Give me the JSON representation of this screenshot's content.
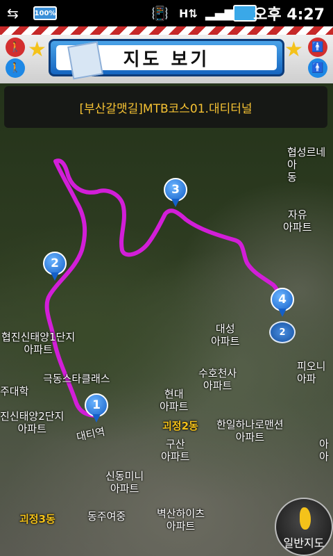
{
  "status_bar": {
    "battery": "100%",
    "time": "오후 4:27"
  },
  "header": {
    "title": "지도 보기"
  },
  "course": {
    "name": "[부산갈맷길]MTB코스01.대티터널"
  },
  "markers": [
    {
      "number": "1"
    },
    {
      "number": "2"
    },
    {
      "number": "3"
    },
    {
      "number": "4"
    }
  ],
  "page_badge": "2",
  "map_labels": {
    "hyupseong": "협성르네\n아\n동",
    "jayu": "자유\n아파트",
    "jinsin1": "협진신태양1단지\n아파트",
    "daeseong": "대성\n아파트",
    "piony": "피오니\n아파",
    "daehak": "주대학",
    "gukdong": "극동스타클래스",
    "suho": "수호천사\n아파트",
    "jinsin2": "진신태양2단지\n아파트",
    "hyundai": "현대\n아파트",
    "daeti": "대티역",
    "goejeong2": "괴정2동",
    "hanil": "한일하나로맨션\n아파트",
    "gusan": "구산\n아파트",
    "right_edge": "아\n아",
    "sindong": "신동미니\n아파트",
    "goejeong3": "괴정3동",
    "dongju": "동주여중",
    "byeoksan": "벽산하이츠\n아파트"
  },
  "buttons": {
    "general_map": "일반지도"
  },
  "colors": {
    "route": "#d21ed8",
    "accent": "#1565c0",
    "course_text": "#f6c233"
  }
}
